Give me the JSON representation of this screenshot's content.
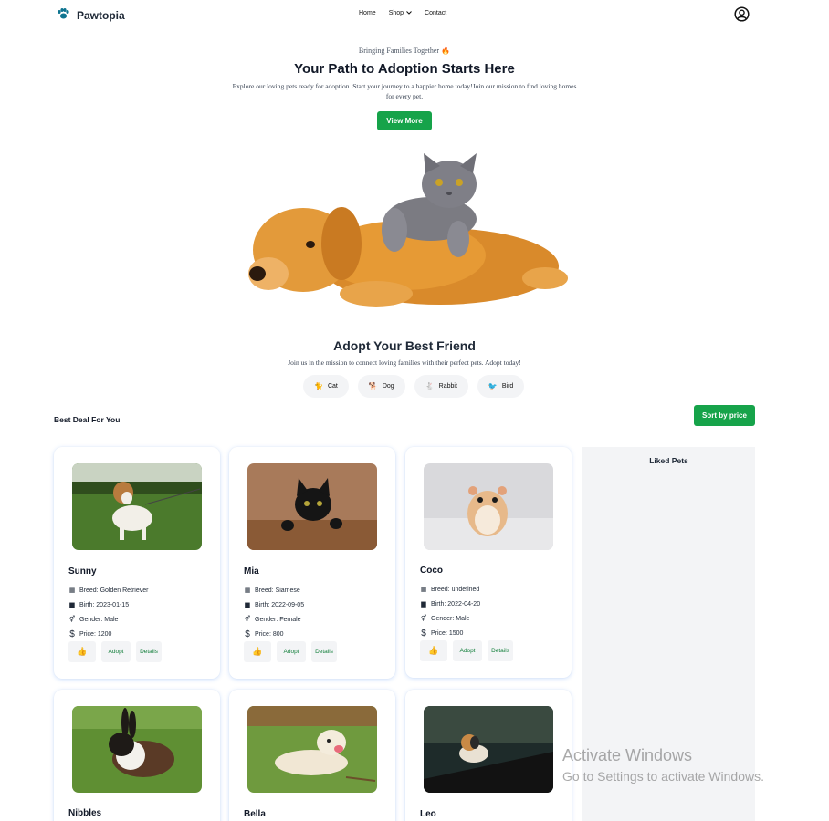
{
  "nav": {
    "brand": "Pawtopia",
    "links": [
      "Home",
      "Shop",
      "Contact"
    ]
  },
  "hero": {
    "tagline": "Bringing Families Together",
    "title": "Your Path to Adoption Starts Here",
    "subtitle": "Explore our loving pets ready for adoption. Start your journey to a happier home today!Join our mission to find loving homes for every pet.",
    "cta": "View More"
  },
  "adopt": {
    "title": "Adopt Your Best Friend",
    "subtitle": "Join us in the mission to connect loving families with their perfect pets. Adopt today!",
    "categories": [
      {
        "icon": "cat-icon",
        "label": "Cat"
      },
      {
        "icon": "dog-icon",
        "label": "Dog"
      },
      {
        "icon": "rabbit-icon",
        "label": "Rabbit"
      },
      {
        "icon": "bird-icon",
        "label": "Bird"
      }
    ]
  },
  "deals": {
    "title": "Best Deal For You",
    "sort_label": "Sort by price"
  },
  "liked": {
    "title": "Liked Pets"
  },
  "pets": [
    {
      "name": "Sunny",
      "breed": "Breed: Golden Retriever",
      "birth": "Birth: 2023-01-15",
      "gender": "Gender: Male",
      "price": "Price: 1200"
    },
    {
      "name": "Mia",
      "breed": "Breed: Siamese",
      "birth": "Birth: 2022-09-05",
      "gender": "Gender: Female",
      "price": "Price: 800"
    },
    {
      "name": "Coco",
      "breed": "Breed: undefined",
      "birth": "Birth: 2022-04-20",
      "gender": "Gender: Male",
      "price": "Price: 1500"
    },
    {
      "name": "Nibbles"
    },
    {
      "name": "Bella"
    },
    {
      "name": "Leo"
    }
  ],
  "actions": {
    "adopt": "Adopt",
    "details": "Details"
  },
  "watermark": {
    "line1": "Activate Windows",
    "line2": "Go to Settings to activate Windows."
  },
  "colors": {
    "accent": "#16a34a",
    "panel": "#f3f4f6",
    "brand_icon": "#0e7490"
  }
}
